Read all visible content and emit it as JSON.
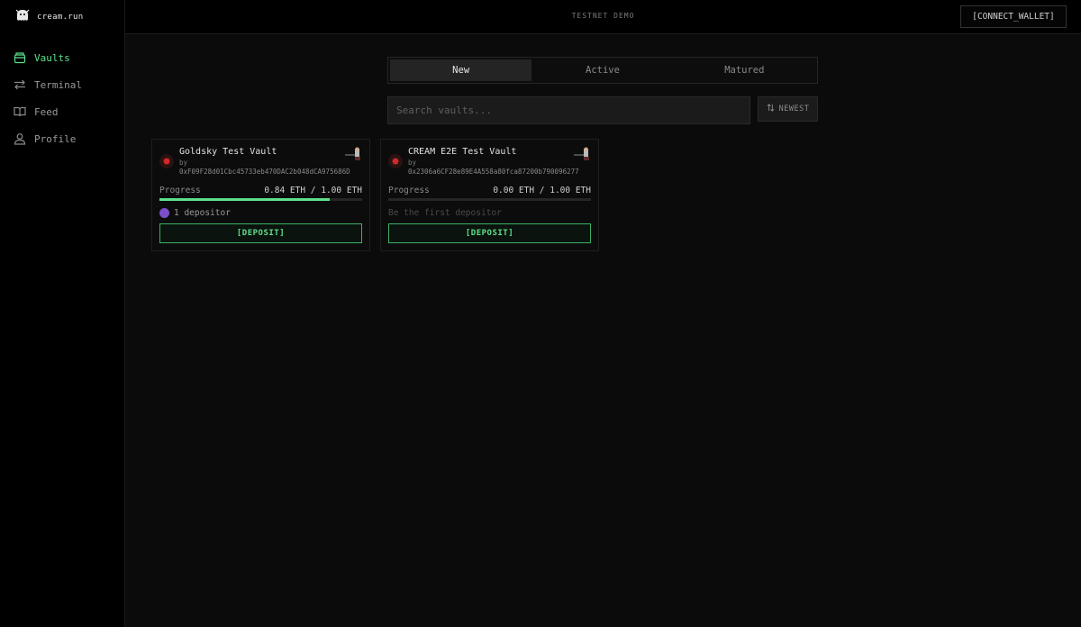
{
  "brand": {
    "name": "cream.run"
  },
  "nav": [
    {
      "label": "Vaults",
      "icon": "box-icon",
      "active": true
    },
    {
      "label": "Terminal",
      "icon": "swap-icon",
      "active": false
    },
    {
      "label": "Feed",
      "icon": "book-icon",
      "active": false
    },
    {
      "label": "Profile",
      "icon": "user-icon",
      "active": false
    }
  ],
  "header": {
    "badge": "TESTNET DEMO",
    "connect_label": "[CONNECT_WALLET]"
  },
  "tabs": [
    "New",
    "Active",
    "Matured"
  ],
  "active_tab": "New",
  "search": {
    "placeholder": "Search vaults..."
  },
  "sort": {
    "label": "NEWEST",
    "icon": "sort-arrows-icon"
  },
  "vaults": [
    {
      "name": "Goldsky Test Vault",
      "by": "by",
      "address": "0xF09F28d01Cbc45733eb470DAC2b048dCA975686D",
      "progress_label": "Progress",
      "progress_text": "0.84 ETH / 1.00 ETH",
      "progress": 0.84,
      "depositors_text": "1 depositor",
      "deposit_label": "[DEPOSIT]"
    },
    {
      "name": "CREAM E2E Test Vault",
      "by": "by",
      "address": "0x2306a6CF28e89E4A558a80fca87200b790096277",
      "progress_label": "Progress",
      "progress_text": "0.00 ETH / 1.00 ETH",
      "progress": 0.0,
      "depositors_text": "Be the first depositor",
      "deposit_label": "[DEPOSIT]"
    }
  ],
  "colors": {
    "accent": "#5ee08a",
    "background": "#0a0a0a"
  }
}
